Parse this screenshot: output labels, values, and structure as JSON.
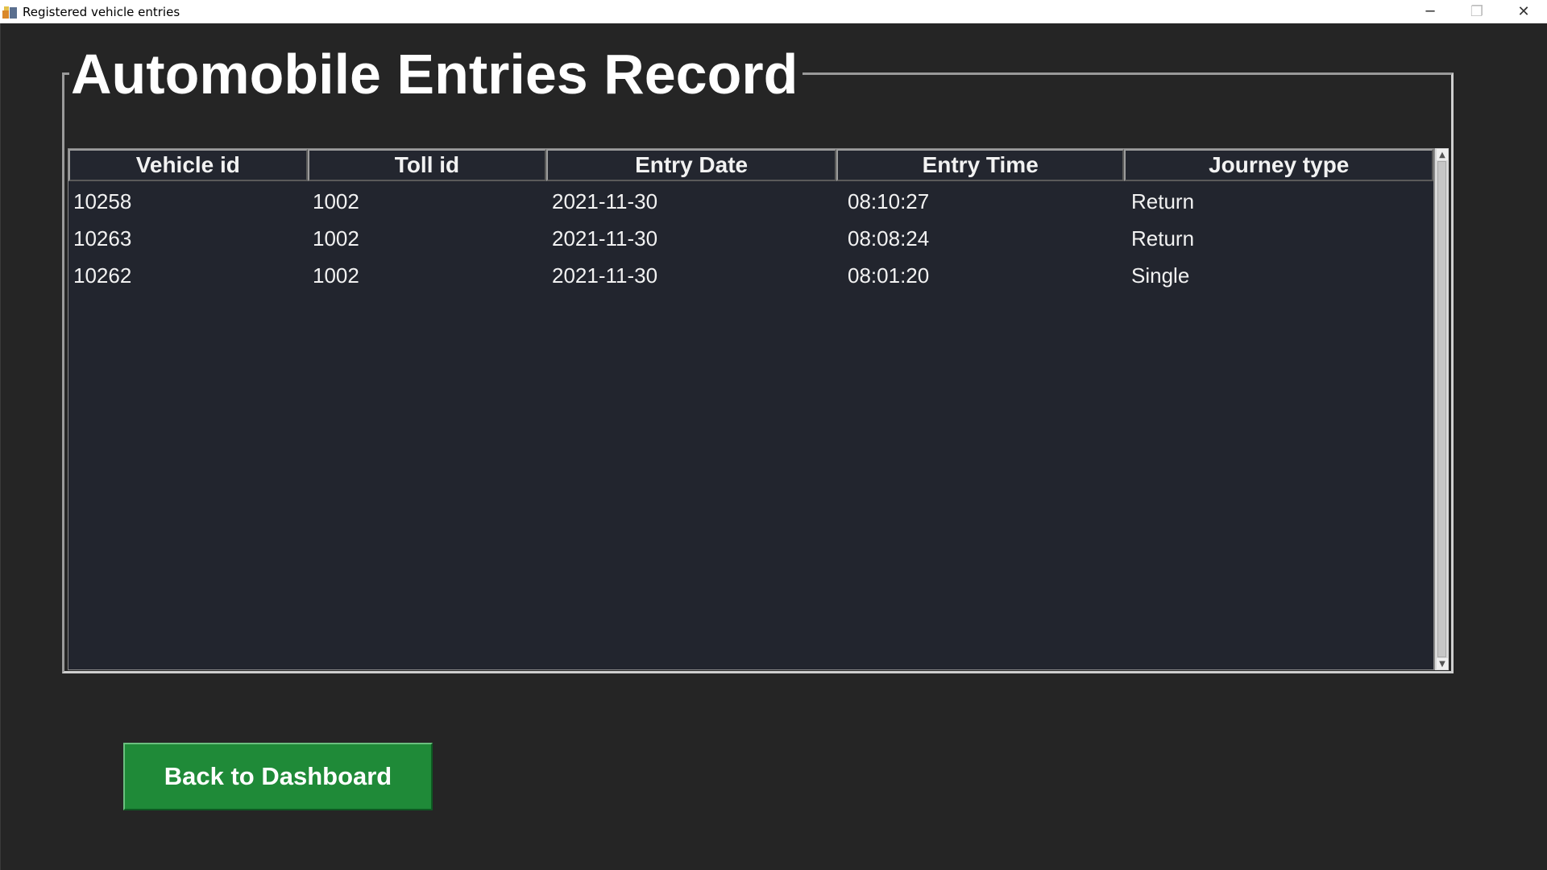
{
  "window": {
    "title": "Registered vehicle entries",
    "controls": {
      "minimize": "─",
      "maximize": "❐",
      "close": "✕"
    }
  },
  "record_frame": {
    "title": "Automobile Entries Record"
  },
  "table": {
    "columns": [
      "Vehicle id",
      "Toll id",
      "Entry Date",
      "Entry Time",
      "Journey type"
    ],
    "rows": [
      [
        "10258",
        "1002",
        "2021-11-30",
        "08:10:27",
        "Return"
      ],
      [
        "10263",
        "1002",
        "2021-11-30",
        "08:08:24",
        "Return"
      ],
      [
        "10262",
        "1002",
        "2021-11-30",
        "08:01:20",
        "Single"
      ]
    ]
  },
  "actions": {
    "back_label": "Back to Dashboard"
  },
  "colors": {
    "background": "#252525",
    "table_background": "#22252e",
    "button": "#1f8a38"
  }
}
